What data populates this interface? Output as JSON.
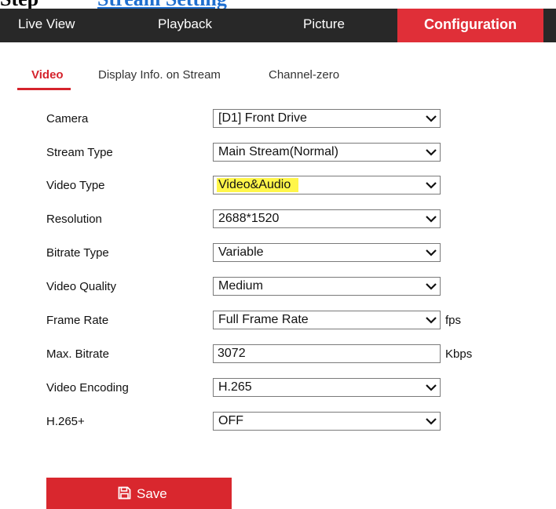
{
  "heading": {
    "step": "Step",
    "link": "Stream Setting"
  },
  "nav": {
    "tabs": [
      "Live View",
      "Playback",
      "Picture",
      "Configuration"
    ],
    "active": "Configuration"
  },
  "subtabs": [
    "Video",
    "Display Info. on Stream",
    "Channel-zero"
  ],
  "form": {
    "camera": {
      "label": "Camera",
      "value": "[D1] Front Drive"
    },
    "stream_type": {
      "label": "Stream Type",
      "value": "Main Stream(Normal)"
    },
    "video_type": {
      "label": "Video Type",
      "value": "Video&Audio"
    },
    "resolution": {
      "label": "Resolution",
      "value": "2688*1520"
    },
    "bitrate_type": {
      "label": "Bitrate Type",
      "value": "Variable"
    },
    "video_quality": {
      "label": "Video Quality",
      "value": "Medium"
    },
    "frame_rate": {
      "label": "Frame Rate",
      "value": "Full Frame Rate",
      "unit": "fps"
    },
    "max_bitrate": {
      "label": "Max. Bitrate",
      "value": "3072",
      "unit": "Kbps"
    },
    "video_encoding": {
      "label": "Video Encoding",
      "value": "H.265"
    },
    "h265plus": {
      "label": "H.265+",
      "value": "OFF"
    }
  },
  "save_label": "Save",
  "colors": {
    "accent": "#e02f38",
    "nav_bg": "#282828",
    "highlight": "#fff64a"
  },
  "icons": {
    "dropdown": "chevron-down-icon",
    "save": "floppy-disk-icon"
  }
}
